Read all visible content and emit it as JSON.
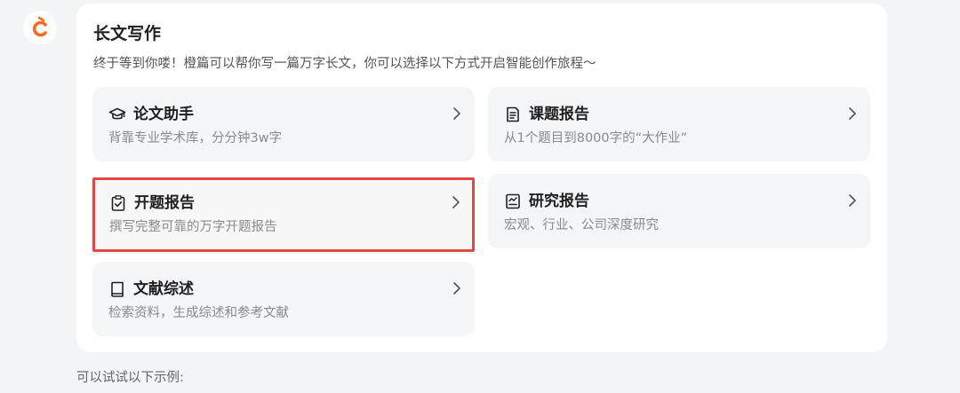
{
  "header": {
    "logo_icon": "orange-c-logo",
    "brand_color": "#f26b21"
  },
  "panel": {
    "title": "长文写作",
    "subtitle": "终于等到你喽！橙篇可以帮你写一篇万字长文，你可以选择以下方式开启智能创作旅程～"
  },
  "cards": [
    {
      "id": "thesis",
      "icon": "graduation-cap-icon",
      "title": "论文助手",
      "desc": "背靠专业学术库，分分钟3w字",
      "selected": false
    },
    {
      "id": "project-report",
      "icon": "document-list-icon",
      "title": "课题报告",
      "desc": "从1个题目到8000字的“大作业”",
      "selected": false
    },
    {
      "id": "proposal",
      "icon": "clipboard-check-icon",
      "title": "开题报告",
      "desc": "撰写完整可靠的万字开题报告",
      "selected": true
    },
    {
      "id": "research",
      "icon": "chart-document-icon",
      "title": "研究报告",
      "desc": "宏观、行业、公司深度研究",
      "selected": false
    },
    {
      "id": "literature",
      "icon": "book-icon",
      "title": "文献综述",
      "desc": "检索资料，生成综述和参考文献",
      "selected": false
    }
  ],
  "selection_color": "#e04848",
  "examples": {
    "label": "可以试试以下示例:"
  }
}
